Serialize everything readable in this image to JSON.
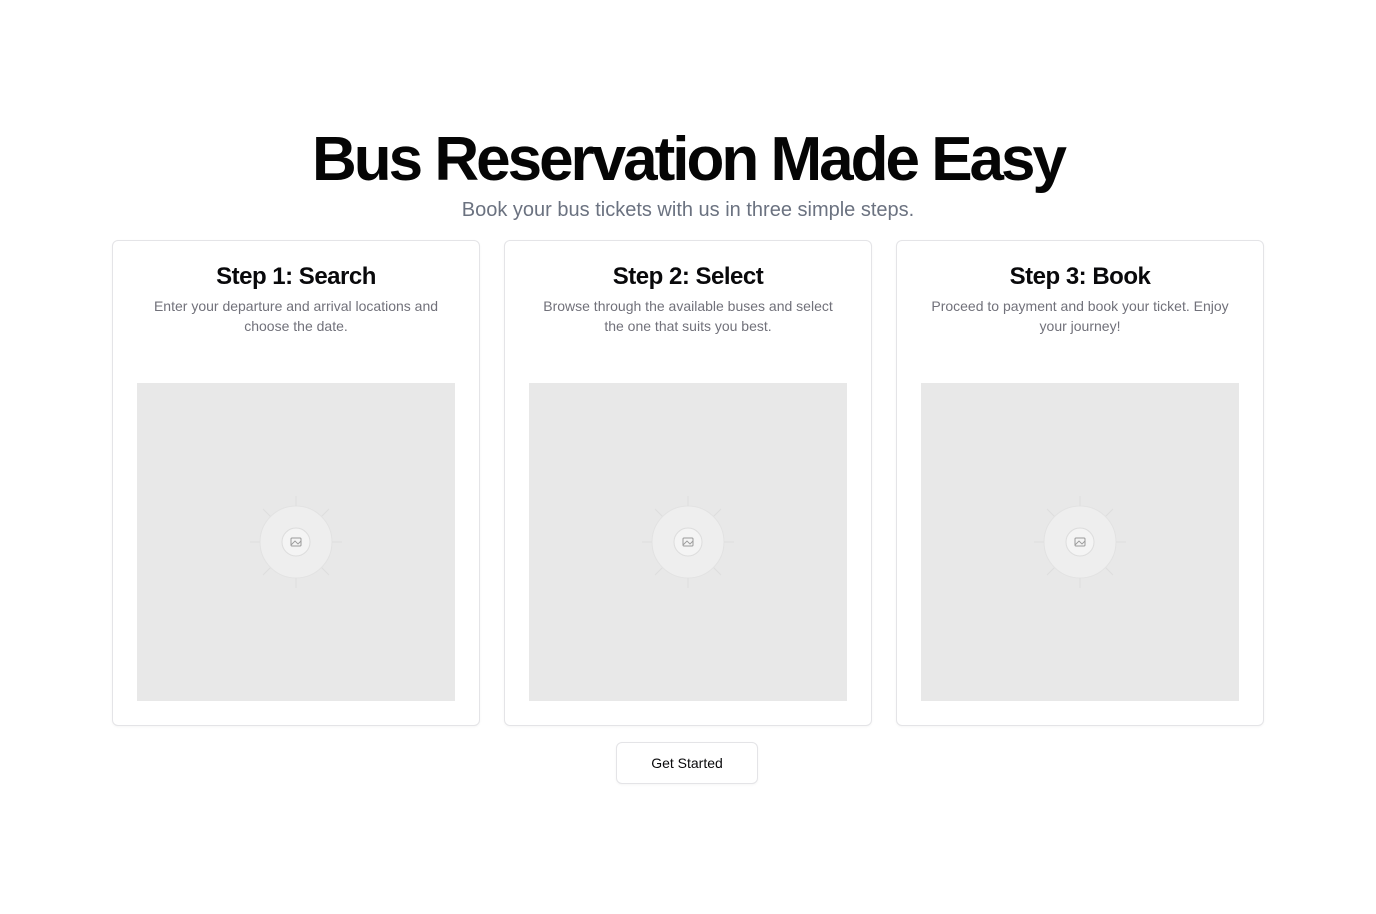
{
  "hero": {
    "title": "Bus Reservation Made Easy",
    "subtitle": "Book your bus tickets with us in three simple steps."
  },
  "steps": [
    {
      "title": "Step 1: Search",
      "description": "Enter your departure and arrival locations and choose the date.",
      "image_icon": "image-placeholder-icon"
    },
    {
      "title": "Step 2: Select",
      "description": "Browse through the available buses and select the one that suits you best.",
      "image_icon": "image-placeholder-icon"
    },
    {
      "title": "Step 3: Book",
      "description": "Proceed to payment and book your ticket. Enjoy your journey!",
      "image_icon": "image-placeholder-icon"
    }
  ],
  "cta": {
    "label": "Get Started"
  },
  "colors": {
    "placeholder_bg": "#e8e8e8",
    "border": "#e4e4e7",
    "muted_text": "#6b7280"
  }
}
